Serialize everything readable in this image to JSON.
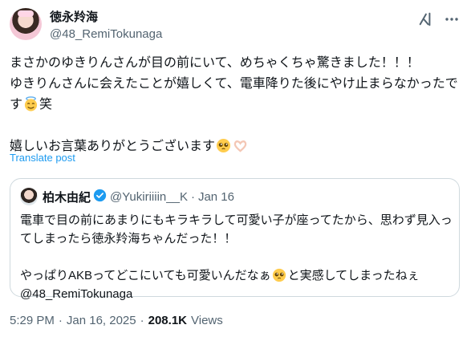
{
  "author": {
    "display_name": "徳永羚海",
    "handle": "@48_RemiTokunaga"
  },
  "tweet": {
    "line1": "まさかのゆきりんさんが目の前にいて、めちゃくちゃ驚きました！！！",
    "line2a": "ゆきりんさんに会えたことが嬉しくて、電車降りた後にやけ止まらなかったです",
    "line2b": "笑",
    "line3": "嬉しいお言葉ありがとうございます",
    "emojis": [
      "smiling-face-with-halo",
      "pleading-face",
      "heart-hands"
    ]
  },
  "translate_label": "Translate post",
  "quote": {
    "display_name": "柏木由紀",
    "handle": "@Yukiriiiin__K",
    "separator": "·",
    "date": "Jan 16",
    "line1": "電車で目の前にあまりにもキラキラして可愛い子が座ってたから、思わず見入ってしまったら徳永羚海ちゃんだった！！",
    "line2a": "やっぱりAKBってどこにいても可愛いんだなぁ",
    "line2b": "と実感してしまったねぇ",
    "line3": "@48_RemiTokunaga",
    "emojis": [
      "pleading-face"
    ]
  },
  "footer": {
    "time": "5:29 PM",
    "sep1": "·",
    "date": "Jan 16, 2025",
    "sep2": "·",
    "views_count": "208.1K",
    "views_label": "Views"
  },
  "colors": {
    "link": "#1d9bf0",
    "muted": "#536471",
    "text": "#0f1419",
    "border": "#cfd9de"
  }
}
